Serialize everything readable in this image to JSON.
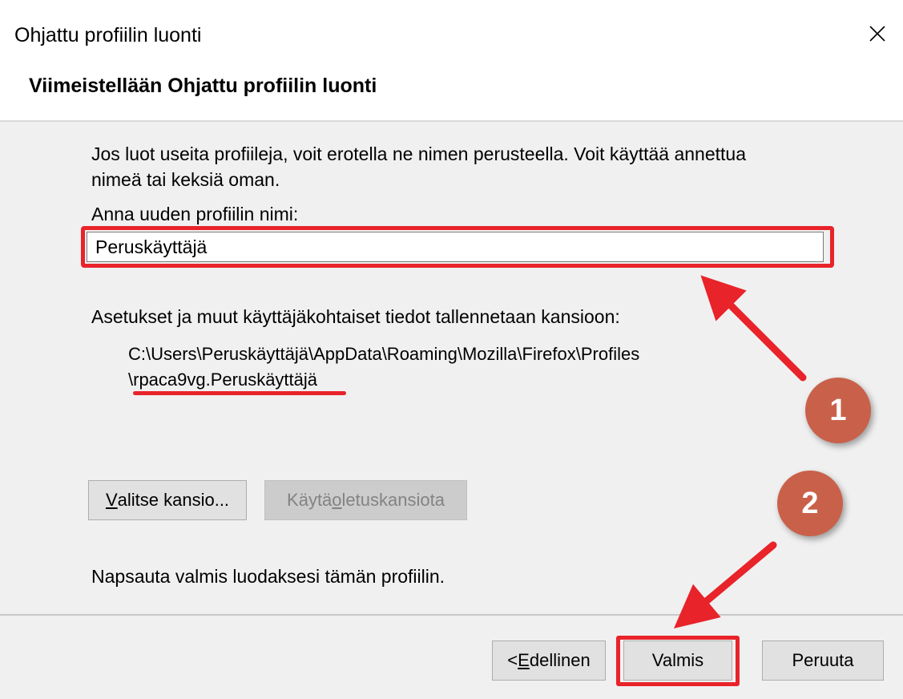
{
  "window": {
    "title": "Ohjattu profiilin luonti",
    "close_icon": "close-icon"
  },
  "header": {
    "title": "Viimeistellään Ohjattu profiilin luonti"
  },
  "content": {
    "intro_line1": "Jos luot useita profiileja, voit erotella ne nimen perusteella. Voit käyttää annettua",
    "intro_line2": "nimeä tai keksiä oman.",
    "name_label": "Anna uuden profiilin nimi:",
    "name_value": "Peruskäyttäjä",
    "folder_label": "Asetukset ja muut käyttäjäkohtaiset tiedot tallennetaan kansioon:",
    "path_line1": "C:\\Users\\Peruskäyttäjä\\AppData\\Roaming\\Mozilla\\Firefox\\Profiles",
    "path_line2": "\\rpaca9vg.Peruskäyttäjä",
    "choose_folder_mnemonic": "V",
    "choose_folder_rest": "alitse kansio...",
    "default_folder_pre": "Käytä ",
    "default_folder_mnemonic": "o",
    "default_folder_rest": "letuskansiota",
    "finish_hint": "Napsauta valmis luodaksesi tämän profiilin."
  },
  "footer": {
    "back_prefix": "< ",
    "back_mnemonic": "E",
    "back_rest": "dellinen",
    "finish_label": "Valmis",
    "cancel_label": "Peruuta"
  },
  "annotations": {
    "badge1": "1",
    "badge2": "2",
    "highlight_color": "#e8232a",
    "badge_color": "#c9614a"
  }
}
